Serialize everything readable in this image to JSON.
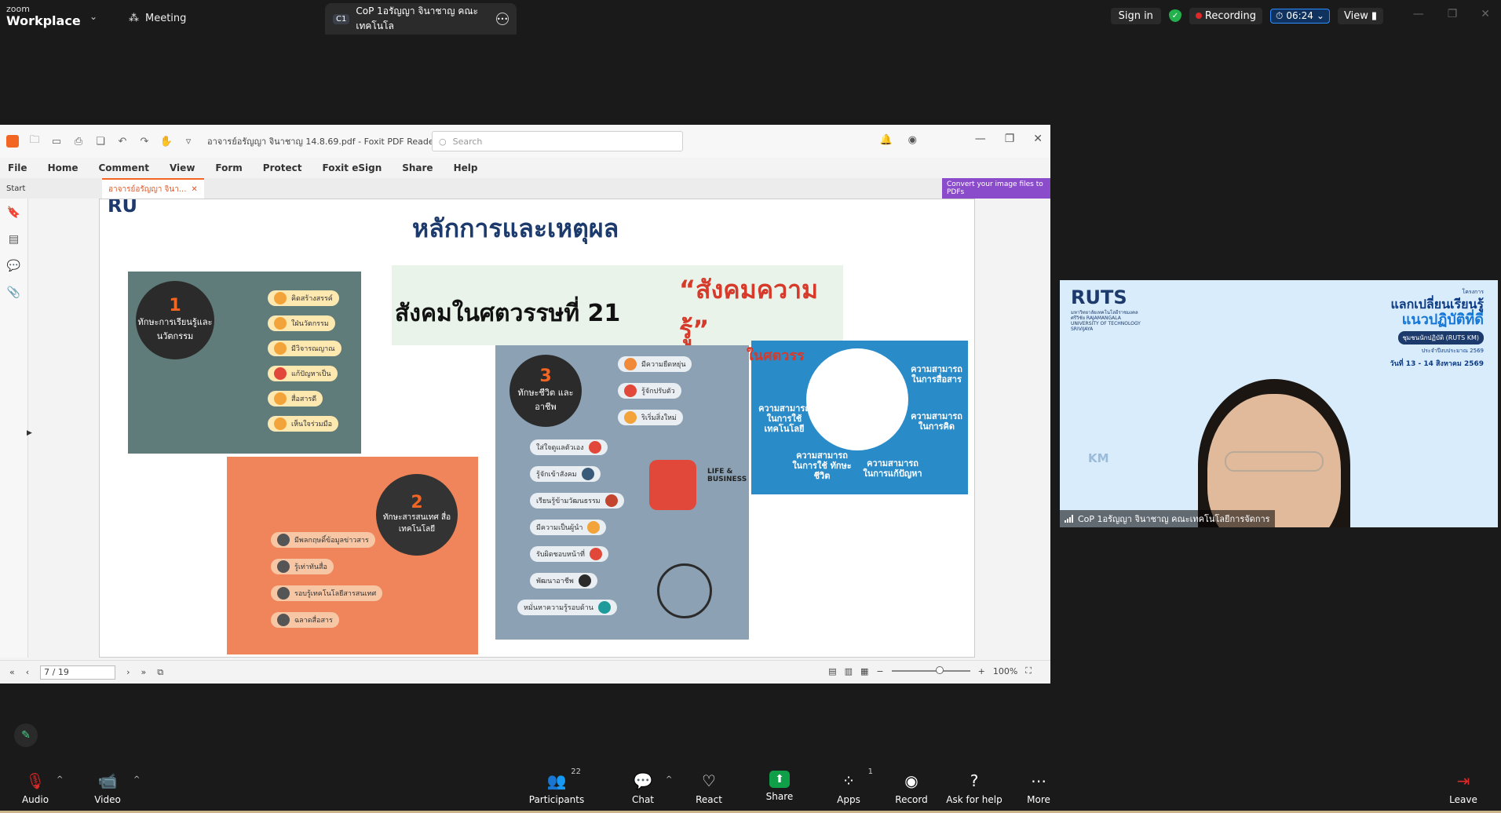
{
  "zoom": {
    "brand_top": "zoom",
    "brand_bottom": "Workplace",
    "meeting_label": "Meeting",
    "tab_badge": "C1",
    "tab_title": "CoP 1อรัญญา จินาชาญ คณะเทคโนโล",
    "signin_label": "Sign in",
    "recording_label": "Recording",
    "timer": "06:24",
    "view_label": "View"
  },
  "foxit": {
    "doc_title": "อาจารย์อรัญญา จินาชาญ 14.8.69.pdf - Foxit PDF Reader",
    "search_placeholder": "Search",
    "menu": [
      "File",
      "Home",
      "Comment",
      "View",
      "Form",
      "Protect",
      "Foxit eSign",
      "Share",
      "Help"
    ],
    "tab_start": "Start",
    "tab_doc": "อาจารย์อรัญญา จินา...",
    "convert_banner": "Convert your image files to PDFs",
    "page_indicator": "7 / 19",
    "zoom_level": "100%"
  },
  "slide": {
    "logo": "RU",
    "title": "หลักการและเหตุผล",
    "banner_left": "สังคมในศตวรรษที่ 21",
    "banner_right": "“สังคมความรู้”",
    "block1": {
      "number": "1",
      "heading": "ทักษะการเรียนรู้และนวัตกรรม",
      "items": [
        "คิดสร้างสรรค์",
        "ใฝ่นวัตกรรม",
        "มีวิจารณญาณ",
        "แก้ปัญหาเป็น",
        "สื่อสารดี",
        "เห็นใจร่วมมือ"
      ]
    },
    "block2": {
      "number": "2",
      "heading": "ทักษะสารสนเทศ สื่อ เทคโนโลยี",
      "items": [
        "มีพลกฤษดิ์ข้อมูลข่าวสาร",
        "รู้เท่าทันสื่อ",
        "รอบรู้เทคโนโลยีสารสนเทศ",
        "ฉลาดสื่อสาร"
      ]
    },
    "block3": {
      "number": "3",
      "heading": "ทักษะชีวิต และอาชีพ",
      "top_items": [
        "มีความยืดหยุ่น",
        "รู้จักปรับตัว",
        "ริเริ่มสิ่งใหม่"
      ],
      "items": [
        "ใส่ใจดูแลตัวเอง",
        "รู้จักเข้าสังคม",
        "เรียนรู้ข้ามวัฒนธรรม",
        "มีความเป็นผู้นำ",
        "รับผิดชอบหน้าที่",
        "พัฒนาอาชีพ",
        "หมั่นหาความรู้รอบด้าน"
      ],
      "life_business": "LIFE & BUSINESS"
    },
    "block4": {
      "corner_text": "ในศตวรร",
      "labels": [
        "ความสามารถ ในการสื่อสาร",
        "ความสามารถ ในการคิด",
        "ความสามารถ ในการแก้ปัญหา",
        "ความสามารถ ในการใช้ ทักษะชีวิต",
        "ความสามารถ ในการใช้ เทคโนโลยี"
      ]
    }
  },
  "video": {
    "ruts": "RUTS",
    "ruts_sub": "มหาวิทยาลัยเทคโนโลยีราชมงคลศรีวิชัย RAJAMANGALA UNIVERSITY OF TECHNOLOGY SRIVIJAYA",
    "project": "โครงการ",
    "headline1": "แลกเปลี่ยนเรียนรู้",
    "headline2": "แนวปฏิบัติที่ดี",
    "pill": "ชุมชนนักปฏิบัติ (RUTS KM)",
    "fiscal": "ประจำปีงบประมาณ 2569",
    "date": "วันที่ 13 - 14 สิงหาคม 2569",
    "km": "KM",
    "participant_name": "CoP 1อรัญญา จินาชาญ คณะเทคโนโลยีการจัดการ"
  },
  "toolbar": {
    "audio": "Audio",
    "video": "Video",
    "participants": "Participants",
    "participants_count": "22",
    "chat": "Chat",
    "react": "React",
    "share": "Share",
    "apps": "Apps",
    "apps_count": "1",
    "record": "Record",
    "ask_for_help": "Ask for help",
    "more": "More",
    "leave": "Leave"
  },
  "colors": {
    "zoom_bg": "#1a1a1a",
    "share_green": "#0e9f48",
    "recording_red": "#e02828",
    "foxit_orange": "#f26522",
    "slide_title": "#1c3a6b"
  }
}
